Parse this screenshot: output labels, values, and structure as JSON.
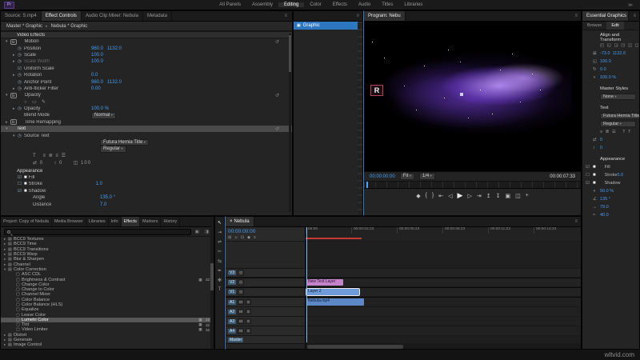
{
  "topbar": {
    "logo": "Pr",
    "workspaces": [
      {
        "label": "All Panels"
      },
      {
        "label": "Assembly"
      },
      {
        "label": "Editing",
        "cls": "active"
      },
      {
        "label": "Color"
      },
      {
        "label": "Effects"
      },
      {
        "label": "Audio"
      },
      {
        "label": "Titles"
      },
      {
        "label": "Libraries"
      }
    ],
    "overflow_icon": "≫"
  },
  "effect_controls": {
    "tabs": [
      {
        "label": "Source: S.mp4"
      },
      {
        "label": "Effect Controls",
        "cls": "active"
      },
      {
        "label": "Audio Clip Mixer: Nebula"
      },
      {
        "label": "Metadata"
      }
    ],
    "menu_icon": "≡",
    "master_label": "Master * Graphic",
    "chevron": "▸",
    "clip_label": "Nebula * Graphic",
    "rows": [
      {
        "cls": "grp",
        "label": "Video Effects"
      },
      {
        "tw": "▾",
        "fx": "fx",
        "label": "Motion",
        "rst": "↺"
      },
      {
        "cls": "ind1",
        "pre": "◷",
        "label": "Position",
        "val": "960.0   1132.0"
      },
      {
        "cls": "ind1",
        "tw": "▸",
        "pre": "◷",
        "label": "Scale",
        "val": "100.0"
      },
      {
        "cls": "ind1 dim",
        "tw": "▸",
        "pre": "◷",
        "label": "Scale Width",
        "val": "100.0"
      },
      {
        "cls": "ind1",
        "pre": "☑",
        "label": "Uniform Scale"
      },
      {
        "cls": "ind1",
        "tw": "▸",
        "pre": "◷",
        "label": "Rotation",
        "val": "0.0"
      },
      {
        "cls": "ind1",
        "pre": "◷",
        "label": "Anchor Point",
        "val": "960.0   1132.0"
      },
      {
        "cls": "ind1",
        "tw": "▸",
        "pre": "◷",
        "label": "Anti-flicker Filter",
        "val": "0.00"
      },
      {
        "tw": "▾",
        "fx": "fx",
        "label": "Opacity",
        "rst": "↺"
      },
      {
        "cls": "ind1 icons",
        "label": "○  ▭  ✎"
      },
      {
        "cls": "ind1",
        "tw": "▸",
        "pre": "◷",
        "label": "Opacity",
        "val": "100.0 %"
      },
      {
        "cls": "ind1",
        "label": "Blend Mode",
        "dd": "Normal"
      },
      {
        "tw": "▸",
        "fx": "fx",
        "label": "Time Remapping"
      },
      {
        "cls": "sel",
        "tw": "▾",
        "label": "Text",
        "rst": "↺"
      },
      {
        "cls": "ind1",
        "tw": "▾",
        "pre": "◷",
        "label": "Source Text"
      },
      {
        "cls": "ind2",
        "dd": "Futura Hernia Title"
      },
      {
        "cls": "ind2",
        "dd": "Regular"
      },
      {
        "cls": "ind2 icons",
        "label": "T   ≡ ≣ ≡ ☰"
      },
      {
        "cls": "ind2 icons",
        "label": "⇄ 0     ↕ 0     ◫ 100"
      },
      {
        "cls": "grp2",
        "label": "Appearance"
      },
      {
        "cls": "ind1",
        "pre": "☑",
        "swatch": "■",
        "label": "Fill"
      },
      {
        "cls": "ind1",
        "pre": "☐",
        "swatch": "■",
        "label": "Stroke",
        "val": "1.0"
      },
      {
        "cls": "ind1",
        "pre": "☑",
        "swatch": "■",
        "label": "Shadow"
      },
      {
        "cls": "ind2",
        "label": "Angle",
        "val": "135.0 °"
      },
      {
        "cls": "ind2",
        "label": "Distance",
        "val": "7.0"
      }
    ]
  },
  "layers_panel": {
    "menu_icon": "≡",
    "items": [
      {
        "icon": "▣",
        "label": "Graphic",
        "cls": "sel"
      }
    ]
  },
  "program": {
    "tab": "Program: Nebu",
    "menu_icon": "≡",
    "logo_letter": "R",
    "tc_current": "00:00:00:00",
    "fit_label": "Fit",
    "res_label": "1/4",
    "tc_duration": "00:00:07:33",
    "transport": [
      {
        "n": "add-marker-button",
        "g": "◆"
      },
      {
        "n": "mark-in-button",
        "g": "{"
      },
      {
        "n": "mark-out-button",
        "g": "}"
      },
      {
        "n": "go-to-in-button",
        "g": "⇤"
      },
      {
        "n": "step-back-button",
        "g": "◁"
      },
      {
        "n": "play-button",
        "g": "▶",
        "cls": "big"
      },
      {
        "n": "step-forward-button",
        "g": "▷"
      },
      {
        "n": "go-to-out-button",
        "g": "⇥"
      },
      {
        "n": "lift-button",
        "g": "↥"
      },
      {
        "n": "extract-button",
        "g": "↧"
      },
      {
        "n": "export-frame-button",
        "g": "▣"
      },
      {
        "n": "comparison-view-button",
        "g": "◫"
      },
      {
        "n": "button-editor-button",
        "g": "+"
      }
    ]
  },
  "essential_graphics": {
    "title": "Essential Graphics",
    "menu_icon": "≡",
    "tabs": [
      {
        "label": "Browse"
      },
      {
        "label": "Edit",
        "cls": "active"
      }
    ],
    "rows": [
      {
        "cls": "sect",
        "label": "Align and Transform"
      },
      {
        "cls": "icons",
        "label": "◰ ◱ ◲ ◳ ◫ ◻"
      },
      {
        "icon": "⊞",
        "val": "-73.0  1132.0"
      },
      {
        "icon": "◱",
        "val": "100.0"
      },
      {
        "icon": "↻",
        "val": "0.0"
      },
      {
        "icon": "◑",
        "val": "100.0 %"
      },
      {
        "cls": "sect",
        "label": "Master Styles"
      },
      {
        "dd": "None"
      },
      {
        "cls": "sect",
        "label": "Text"
      },
      {
        "dd": "Futura Hernia Title"
      },
      {
        "dd": "Regular"
      },
      {
        "cls": "icons",
        "label": "≡ ≣ ☰   T T"
      },
      {
        "icon": "⇄",
        "val": "0"
      },
      {
        "icon": "↕",
        "val": "0"
      },
      {
        "cls": "sect",
        "label": "Appearance"
      },
      {
        "cb": "☑",
        "swatch": "■",
        "label": "Fill"
      },
      {
        "cb": "☐",
        "swatch": "■",
        "label": "Stroke",
        "val": "5.0"
      },
      {
        "cb": "☑",
        "swatch": "■",
        "label": "Shadow"
      },
      {
        "icon": "◑",
        "val": "50.0 %"
      },
      {
        "icon": "∠",
        "val": "135 °"
      },
      {
        "icon": "↔",
        "val": "79.0"
      },
      {
        "icon": "≈",
        "val": "40.0"
      }
    ]
  },
  "project": {
    "tabs": [
      {
        "label": "Project: Copy of Nebula"
      },
      {
        "label": "Media Browser"
      },
      {
        "label": "Libraries"
      },
      {
        "label": "Info"
      },
      {
        "label": "Effects",
        "cls": "active"
      },
      {
        "label": "Markers"
      },
      {
        "label": "History"
      }
    ],
    "menu_icon": "≡",
    "tree": [
      {
        "tw": "▸",
        "icon": "▤",
        "label": "BCC9 Textures"
      },
      {
        "tw": "▸",
        "icon": "▤",
        "label": "BCC9 Time"
      },
      {
        "tw": "▸",
        "icon": "▤",
        "label": "BCC9 Transitions"
      },
      {
        "tw": "▸",
        "icon": "▤",
        "label": "BCC9 Warp"
      },
      {
        "tw": "▸",
        "icon": "▤",
        "label": "Blur & Sharpen"
      },
      {
        "tw": "▸",
        "icon": "▤",
        "label": "Channel"
      },
      {
        "tw": "▾",
        "icon": "▤",
        "label": "Color Correction"
      },
      {
        "cls": "ind1",
        "icon": "▢",
        "label": "ASC CDL"
      },
      {
        "cls": "ind1",
        "icon": "▢",
        "label": "Brightness & Contrast",
        "b1": "▦",
        "b2": "32"
      },
      {
        "cls": "ind1",
        "icon": "▢",
        "label": "Change Color"
      },
      {
        "cls": "ind1",
        "icon": "▢",
        "label": "Change to Color"
      },
      {
        "cls": "ind1",
        "icon": "▢",
        "label": "Channel Mixer"
      },
      {
        "cls": "ind1",
        "icon": "▢",
        "label": "Color Balance"
      },
      {
        "cls": "ind1",
        "icon": "▢",
        "label": "Color Balance (HLS)"
      },
      {
        "cls": "ind1",
        "icon": "▢",
        "label": "Equalize"
      },
      {
        "cls": "ind1",
        "icon": "▢",
        "label": "Leave Color"
      },
      {
        "cls": "ind1 sel",
        "icon": "▢",
        "label": "Lumetri Color",
        "b1": "▦",
        "b2": "32"
      },
      {
        "cls": "ind1",
        "icon": "▢",
        "label": "Tint",
        "b1": "▦",
        "b2": "32"
      },
      {
        "cls": "ind1",
        "icon": "▢",
        "label": "Video Limiter",
        "b1": "▦",
        "b2": "32"
      },
      {
        "tw": "▸",
        "icon": "▤",
        "label": "Distort"
      },
      {
        "tw": "▸",
        "icon": "▤",
        "label": "Generate"
      },
      {
        "tw": "▸",
        "icon": "▤",
        "label": "Image Control"
      }
    ]
  },
  "timeline": {
    "close_icon": "×",
    "tab": "Nebula",
    "menu_icon": "≡",
    "tc": "00:00:00:00",
    "toolbar_icons": [
      {
        "n": "nest-icon",
        "g": "⊞"
      },
      {
        "n": "snap-icon",
        "g": "∪"
      },
      {
        "n": "linked-selection-icon",
        "g": "⊡"
      },
      {
        "n": "add-marker-icon",
        "g": "◆"
      },
      {
        "n": "timeline-settings-icon",
        "g": "≡"
      }
    ],
    "ruler_labels": [
      "00:00",
      "00:00:02:23",
      "00:00:05:23",
      "00:00:08:23",
      "00:00:11:23",
      "00:00:14:23"
    ],
    "tracks": [
      {
        "head": "V3",
        "cls": "video",
        "t1": "⊙"
      },
      {
        "head": "V2",
        "cls": "video",
        "t1": "⊙",
        "clipLabel": "New Text Layer",
        "clipCls": "clip-pink",
        "clipStyle": "left:1px;width:46px"
      },
      {
        "head": "V1",
        "cls": "video",
        "t1": "⊙",
        "clipLabel": "Layer 2",
        "clipCls": "clip-blue selclip",
        "clipStyle": "left:1px;width:66px"
      },
      {
        "head": "A1",
        "cls": "audio",
        "t1": "M",
        "t2": "S",
        "clipLabel": "Nebula.mp4",
        "clipCls": "clip-audio",
        "clipStyle": "left:1px;width:72px"
      },
      {
        "head": "A2",
        "cls": "audio",
        "t1": "M",
        "t2": "S"
      },
      {
        "head": "A3",
        "cls": "audio",
        "t1": "M",
        "t2": "S"
      },
      {
        "head": "A4",
        "cls": "audio",
        "t1": "M",
        "t2": "S"
      }
    ],
    "master_label": "Master",
    "tools": [
      {
        "n": "selection-tool",
        "g": "↖",
        "cls": "active"
      },
      {
        "n": "track-select-tool",
        "g": "⇥"
      },
      {
        "n": "ripple-edit-tool",
        "g": "⇌"
      },
      {
        "n": "razor-tool",
        "g": "✂"
      },
      {
        "n": "slip-tool",
        "g": "⇆"
      },
      {
        "n": "pen-tool",
        "g": "✒"
      },
      {
        "n": "hand-tool",
        "g": "✥"
      },
      {
        "n": "type-tool",
        "g": "T"
      }
    ]
  },
  "watermark": "wltvid.com"
}
